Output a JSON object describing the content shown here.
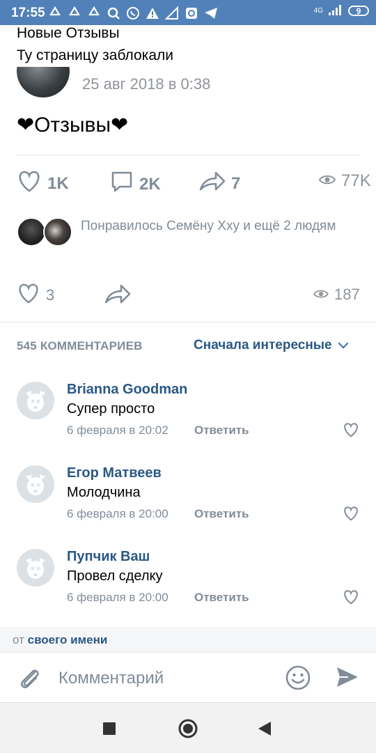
{
  "status_bar": {
    "time": "17:55",
    "network": "4G",
    "battery": "9"
  },
  "post": {
    "lines": [
      "Новые Отзывы",
      "Ту страницу заблокали"
    ],
    "date": "25 авг 2018 в 0:38",
    "text": "❤Отзывы❤",
    "likes": "1K",
    "comments": "2K",
    "shares": "7",
    "views": "77K"
  },
  "liked_by": {
    "text": "Понравилось Семёну Ххy и ещё 2 людям"
  },
  "repost_actions": {
    "likes": "3",
    "views": "187"
  },
  "comments_header": {
    "count_label": "545 КОММЕНТАРИЕВ",
    "sort_label": "Сначала интересные"
  },
  "comments": [
    {
      "author": "Brianna Goodman",
      "text": "Супер просто",
      "date": "6 февраля в 20:02",
      "reply": "Ответить"
    },
    {
      "author": "Егор Матвеев",
      "text": "Молодчина",
      "date": "6 февраля в 20:00",
      "reply": "Ответить"
    },
    {
      "author": "Пупчик Ваш",
      "text": "Провел сделку",
      "date": "6 февраля в 20:00",
      "reply": "Ответить"
    }
  ],
  "from_bar": {
    "prefix": "от",
    "link": "своего имени"
  },
  "composer": {
    "placeholder": "Комментарий"
  },
  "colors": {
    "accent": "#5181b8",
    "link": "#2a5885",
    "secondary": "#818c99",
    "heart": "#e64646"
  }
}
